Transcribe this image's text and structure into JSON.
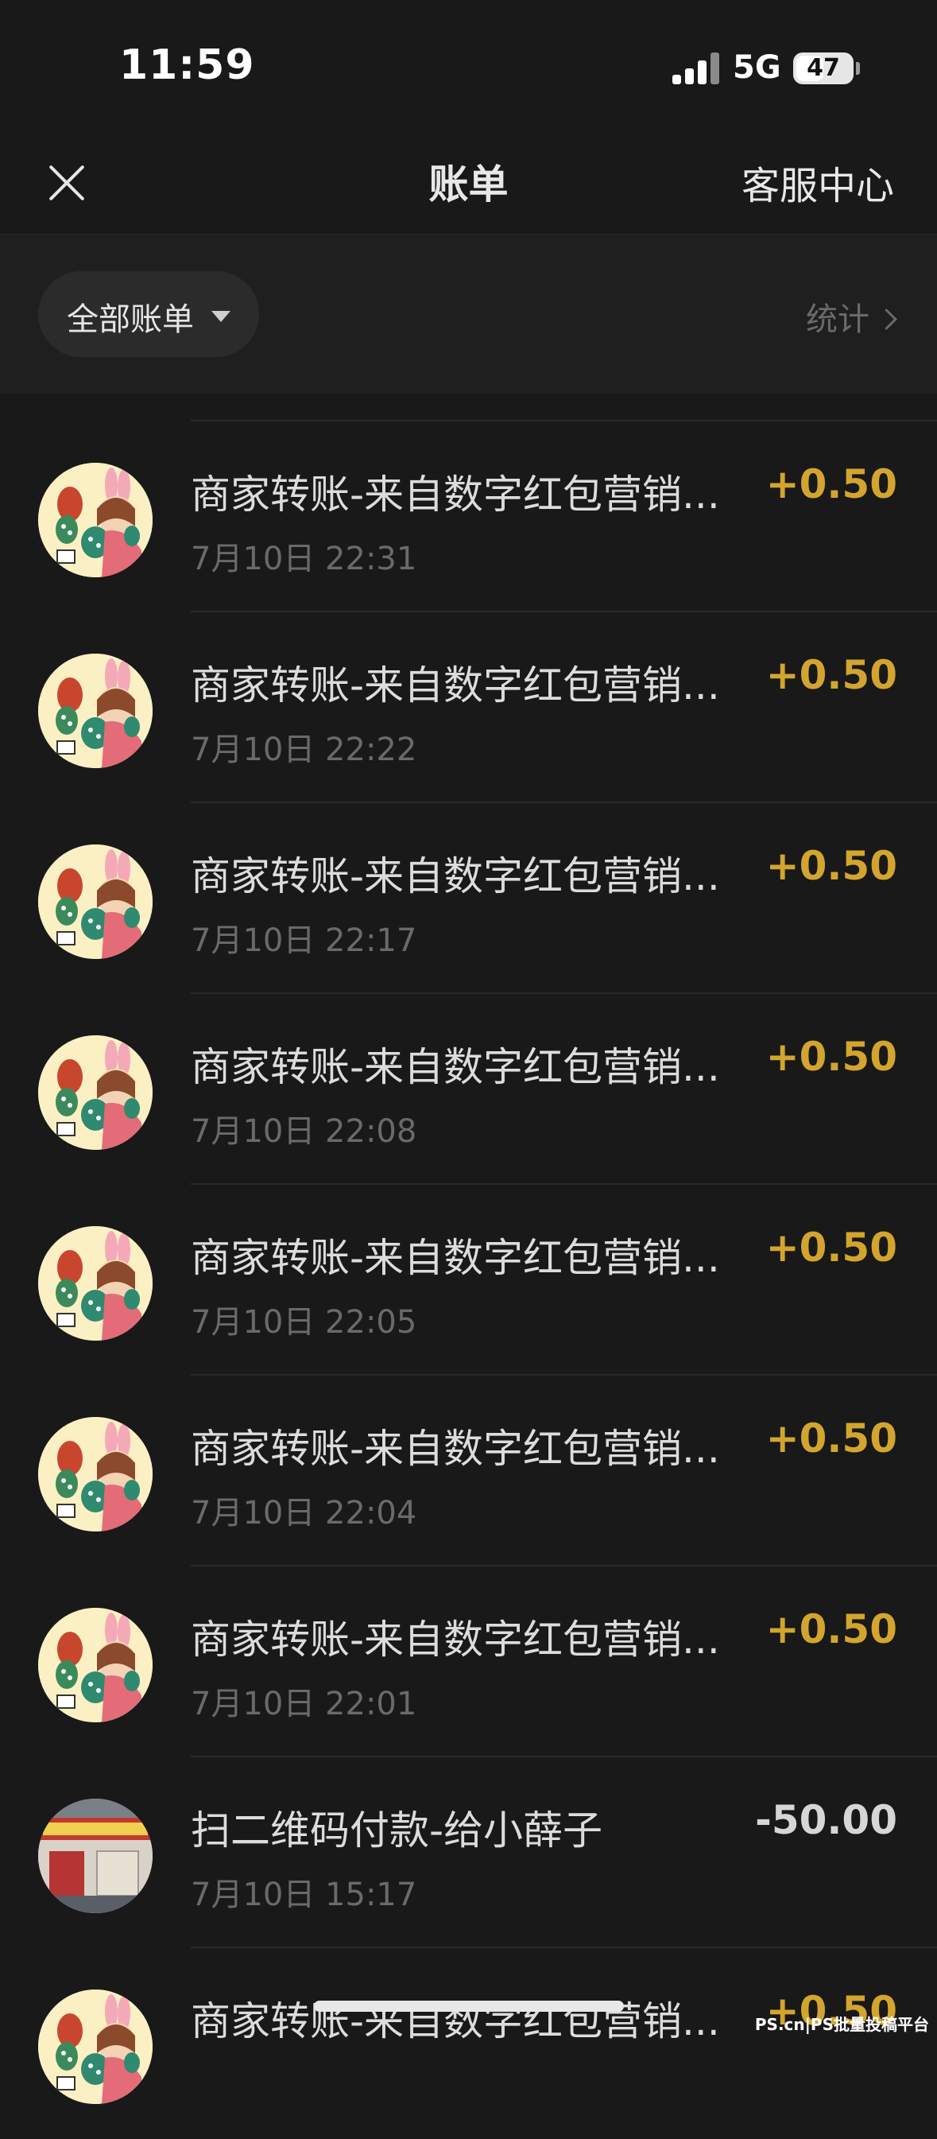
{
  "status_bar": {
    "time": "11:59",
    "network": "5G",
    "battery": "47"
  },
  "header": {
    "title": "账单",
    "right_link": "客服中心"
  },
  "filter": {
    "selected": "全部账单",
    "stats_label": "统计"
  },
  "colors": {
    "income": "#d3a52f",
    "expense": "#d6d6d6",
    "background": "#191919"
  },
  "transactions": [
    {
      "title": "商家转账-来自数字红包营销...",
      "time": "7月10日 22:31",
      "amount": "+0.50",
      "avatar": "bunny-girl-avatar"
    },
    {
      "title": "商家转账-来自数字红包营销...",
      "time": "7月10日 22:22",
      "amount": "+0.50",
      "avatar": "bunny-girl-avatar"
    },
    {
      "title": "商家转账-来自数字红包营销...",
      "time": "7月10日 22:17",
      "amount": "+0.50",
      "avatar": "bunny-girl-avatar"
    },
    {
      "title": "商家转账-来自数字红包营销...",
      "time": "7月10日 22:08",
      "amount": "+0.50",
      "avatar": "bunny-girl-avatar"
    },
    {
      "title": "商家转账-来自数字红包营销...",
      "time": "7月10日 22:05",
      "amount": "+0.50",
      "avatar": "bunny-girl-avatar"
    },
    {
      "title": "商家转账-来自数字红包营销...",
      "time": "7月10日 22:04",
      "amount": "+0.50",
      "avatar": "bunny-girl-avatar"
    },
    {
      "title": "商家转账-来自数字红包营销...",
      "time": "7月10日 22:01",
      "amount": "+0.50",
      "avatar": "bunny-girl-avatar"
    },
    {
      "title": "扫二维码付款-给小薛子",
      "time": "7月10日 15:17",
      "amount": "-50.00",
      "avatar": "storefront-avatar"
    },
    {
      "title": "商家转账-来自数字红包营销...",
      "time": "",
      "amount": "+0.50",
      "avatar": "bunny-girl-avatar"
    }
  ],
  "watermark": "PS.cn|PS批量投稿平台"
}
